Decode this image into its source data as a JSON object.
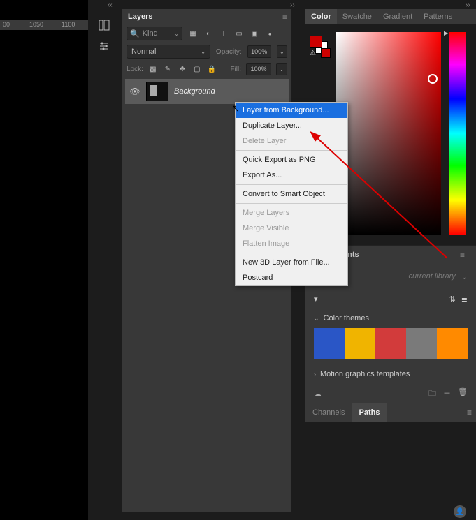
{
  "ruler": {
    "t1": "00",
    "t2": "1050",
    "t3": "1100"
  },
  "layers_panel": {
    "title": "Layers",
    "kind_label": "Kind",
    "blend_mode": "Normal",
    "opacity_label": "Opacity:",
    "opacity_value": "100%",
    "lock_label": "Lock:",
    "fill_label": "Fill:",
    "fill_value": "100%",
    "layer_name": "Background"
  },
  "context_menu": {
    "items": [
      {
        "label": "Layer from Background...",
        "state": "selected"
      },
      {
        "label": "Duplicate Layer...",
        "state": "normal"
      },
      {
        "label": "Delete Layer",
        "state": "disabled"
      },
      {
        "sep": true
      },
      {
        "label": "Quick Export as PNG",
        "state": "normal"
      },
      {
        "label": "Export As...",
        "state": "normal"
      },
      {
        "sep": true
      },
      {
        "label": "Convert to Smart Object",
        "state": "normal"
      },
      {
        "sep": true
      },
      {
        "label": "Merge Layers",
        "state": "disabled"
      },
      {
        "label": "Merge Visible",
        "state": "disabled"
      },
      {
        "label": "Flatten Image",
        "state": "disabled"
      },
      {
        "sep": true
      },
      {
        "label": "New 3D Layer from File...",
        "state": "normal"
      },
      {
        "label": "Postcard",
        "state": "normal"
      }
    ]
  },
  "color_panel": {
    "tabs": {
      "color": "Color",
      "swatches": "Swatche",
      "gradient": "Gradient",
      "patterns": "Patterns"
    }
  },
  "adjustments": {
    "title": "Adjustments"
  },
  "libraries": {
    "placeholder": "current library"
  },
  "themes": {
    "title": "Color themes",
    "colors": [
      "#2a56c6",
      "#f0b400",
      "#d23b3b",
      "#7a7a7a",
      "#ff8a00"
    ]
  },
  "motion": {
    "title": "Motion graphics templates"
  },
  "bottom_tabs": {
    "channels": "Channels",
    "paths": "Paths"
  },
  "chart_data": null
}
